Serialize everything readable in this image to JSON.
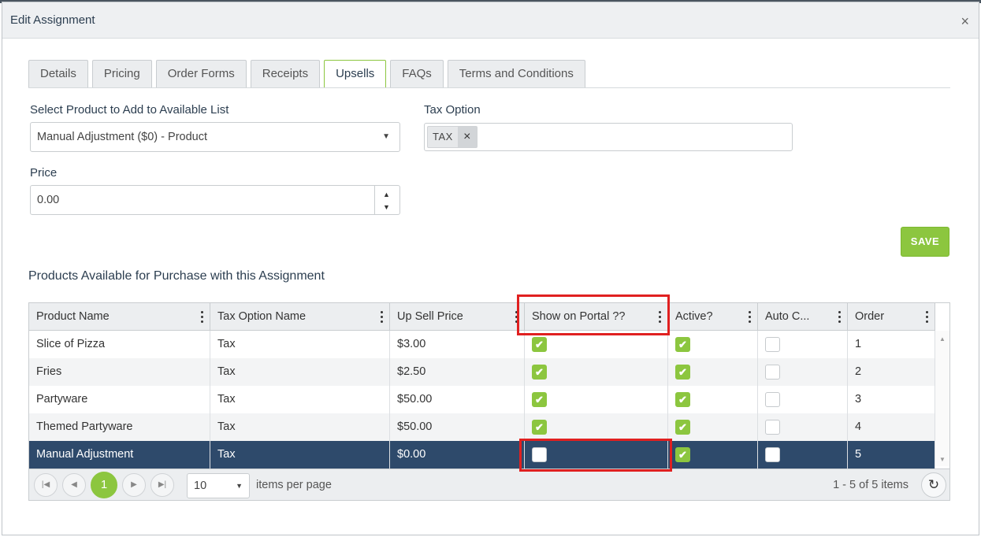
{
  "dialog": {
    "title": "Edit Assignment",
    "close_glyph": "×"
  },
  "tabs": [
    "Details",
    "Pricing",
    "Order Forms",
    "Receipts",
    "Upsells",
    "FAQs",
    "Terms and Conditions"
  ],
  "active_tab": "Upsells",
  "form": {
    "product_label": "Select Product to Add to Available List",
    "product_value": "Manual Adjustment ($0) - Product",
    "tax_label": "Tax Option",
    "tax_chip": "TAX",
    "tax_chip_remove": "×",
    "price_label": "Price",
    "price_value": "0.00",
    "save_label": "SAVE"
  },
  "section_title": "Products Available for Purchase with this Assignment",
  "grid": {
    "columns": [
      "Product Name",
      "Tax Option Name",
      "Up Sell Price",
      "Show on Portal ??",
      "Active?",
      "Auto C...",
      "Order"
    ],
    "rows": [
      {
        "product": "Slice of Pizza",
        "tax": "Tax",
        "price": "$3.00",
        "portal": true,
        "active": true,
        "auto": false,
        "order": "1"
      },
      {
        "product": "Fries",
        "tax": "Tax",
        "price": "$2.50",
        "portal": true,
        "active": true,
        "auto": false,
        "order": "2"
      },
      {
        "product": "Partyware",
        "tax": "Tax",
        "price": "$50.00",
        "portal": true,
        "active": true,
        "auto": false,
        "order": "3"
      },
      {
        "product": "Themed Partyware",
        "tax": "Tax",
        "price": "$50.00",
        "portal": true,
        "active": true,
        "auto": false,
        "order": "4"
      },
      {
        "product": "Manual Adjustment",
        "tax": "Tax",
        "price": "$0.00",
        "portal": false,
        "active": true,
        "auto": false,
        "order": "5"
      }
    ],
    "selected_row": 5
  },
  "pager": {
    "current_page": "1",
    "page_size": "10",
    "items_per_page": "items per page",
    "info": "1 - 5 of 5 items"
  },
  "colors": {
    "accent": "#8cc63f",
    "selected_row": "#2e4a6b",
    "highlight": "#e02020"
  },
  "icons": [
    "close-icon",
    "chevron-down-icon",
    "spinner-up-icon",
    "spinner-down-icon",
    "kebab-menu-icon",
    "check-icon",
    "first-page-icon",
    "prev-page-icon",
    "next-page-icon",
    "last-page-icon",
    "refresh-icon"
  ]
}
